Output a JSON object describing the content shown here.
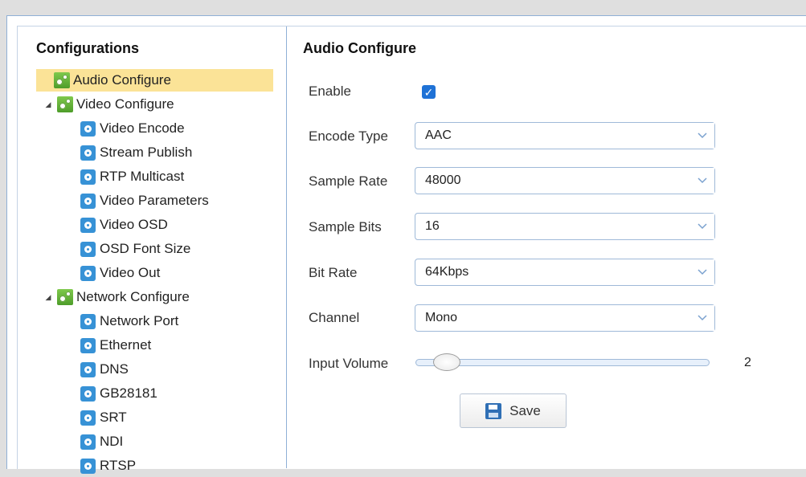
{
  "sidebar": {
    "title": "Configurations",
    "items": [
      {
        "label": "Audio Configure",
        "icon": "gear-group-icon",
        "level": 0,
        "selected": true
      },
      {
        "label": "Video Configure",
        "icon": "gear-group-icon",
        "level": 0,
        "expanded": true
      },
      {
        "label": "Video Encode",
        "icon": "gear-icon",
        "level": 1
      },
      {
        "label": "Stream Publish",
        "icon": "gear-icon",
        "level": 1
      },
      {
        "label": "RTP Multicast",
        "icon": "gear-icon",
        "level": 1
      },
      {
        "label": "Video Parameters",
        "icon": "gear-icon",
        "level": 1
      },
      {
        "label": "Video OSD",
        "icon": "gear-icon",
        "level": 1
      },
      {
        "label": "OSD Font Size",
        "icon": "gear-icon",
        "level": 1
      },
      {
        "label": "Video Out",
        "icon": "gear-icon",
        "level": 1
      },
      {
        "label": "Network Configure",
        "icon": "gear-group-icon",
        "level": 0,
        "expanded": true
      },
      {
        "label": "Network Port",
        "icon": "gear-icon",
        "level": 1
      },
      {
        "label": "Ethernet",
        "icon": "gear-icon",
        "level": 1
      },
      {
        "label": "DNS",
        "icon": "gear-icon",
        "level": 1
      },
      {
        "label": "GB28181",
        "icon": "gear-icon",
        "level": 1
      },
      {
        "label": "SRT",
        "icon": "gear-icon",
        "level": 1
      },
      {
        "label": "NDI",
        "icon": "gear-icon",
        "level": 1
      },
      {
        "label": "RTSP",
        "icon": "gear-icon",
        "level": 1
      }
    ]
  },
  "audio": {
    "title": "Audio Configure",
    "enable_label": "Enable",
    "enable_checked": true,
    "encode_type": {
      "label": "Encode Type",
      "value": "AAC"
    },
    "sample_rate": {
      "label": "Sample Rate",
      "value": "48000"
    },
    "sample_bits": {
      "label": "Sample Bits",
      "value": "16"
    },
    "bit_rate": {
      "label": "Bit Rate",
      "value": "64Kbps"
    },
    "channel": {
      "label": "Channel",
      "value": "Mono"
    },
    "input_volume": {
      "label": "Input Volume",
      "value": "2"
    },
    "save_label": "Save"
  },
  "colors": {
    "selected_bg": "#fbe397",
    "accent": "#1f72d6",
    "border": "#9fb9d8"
  }
}
